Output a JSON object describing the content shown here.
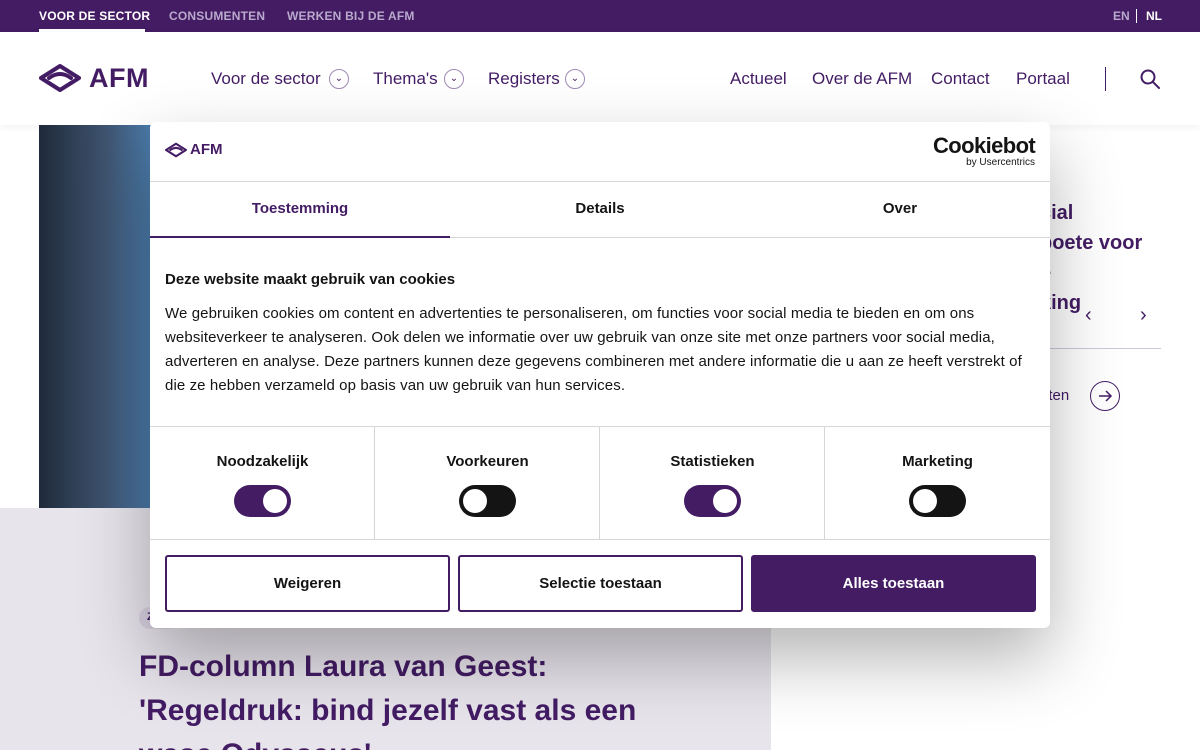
{
  "topbar": {
    "links": [
      "VOOR DE SECTOR",
      "CONSUMENTEN",
      "WERKEN BIJ DE AFM"
    ],
    "lang_en": "EN",
    "lang_nl": "NL"
  },
  "header": {
    "logo": "AFM",
    "nav_left": [
      "Voor de sector",
      "Thema's",
      "Registers"
    ],
    "nav_right": [
      "Actueel",
      "Over de AFM",
      "Contact",
      "Portaal"
    ]
  },
  "background": {
    "tag": "Z",
    "headline": "FD-column Laura van Geest: 'Regeldruk: bind jezelf vast als een wase Odysseus'",
    "right_news_lines": [
      "cial",
      "boete voor",
      "e",
      "king"
    ],
    "all_news": "hten"
  },
  "cookie_dialog": {
    "logo": "AFM",
    "brand": "Cookiebot",
    "brand_sub": "by Usercentrics",
    "tabs": [
      "Toestemming",
      "Details",
      "Over"
    ],
    "title": "Deze website maakt gebruik van cookies",
    "text": "We gebruiken cookies om content en advertenties te personaliseren, om functies voor social media te bieden en om ons websiteverkeer te analyseren. Ook delen we informatie over uw gebruik van onze site met onze partners voor social media, adverteren en analyse. Deze partners kunnen deze gegevens combineren met andere informatie die u aan ze heeft verstrekt of die ze hebben verzameld op basis van uw gebruik van hun services.",
    "categories": [
      {
        "label": "Noodzakelijk",
        "enabled": true
      },
      {
        "label": "Voorkeuren",
        "enabled": false
      },
      {
        "label": "Statistieken",
        "enabled": true
      },
      {
        "label": "Marketing",
        "enabled": false
      }
    ],
    "buttons": {
      "reject": "Weigeren",
      "allow_selection": "Selectie toestaan",
      "allow_all": "Alles toestaan"
    }
  },
  "colors": {
    "brand_purple": "#431c64",
    "lilac": "#e8e4ec"
  }
}
